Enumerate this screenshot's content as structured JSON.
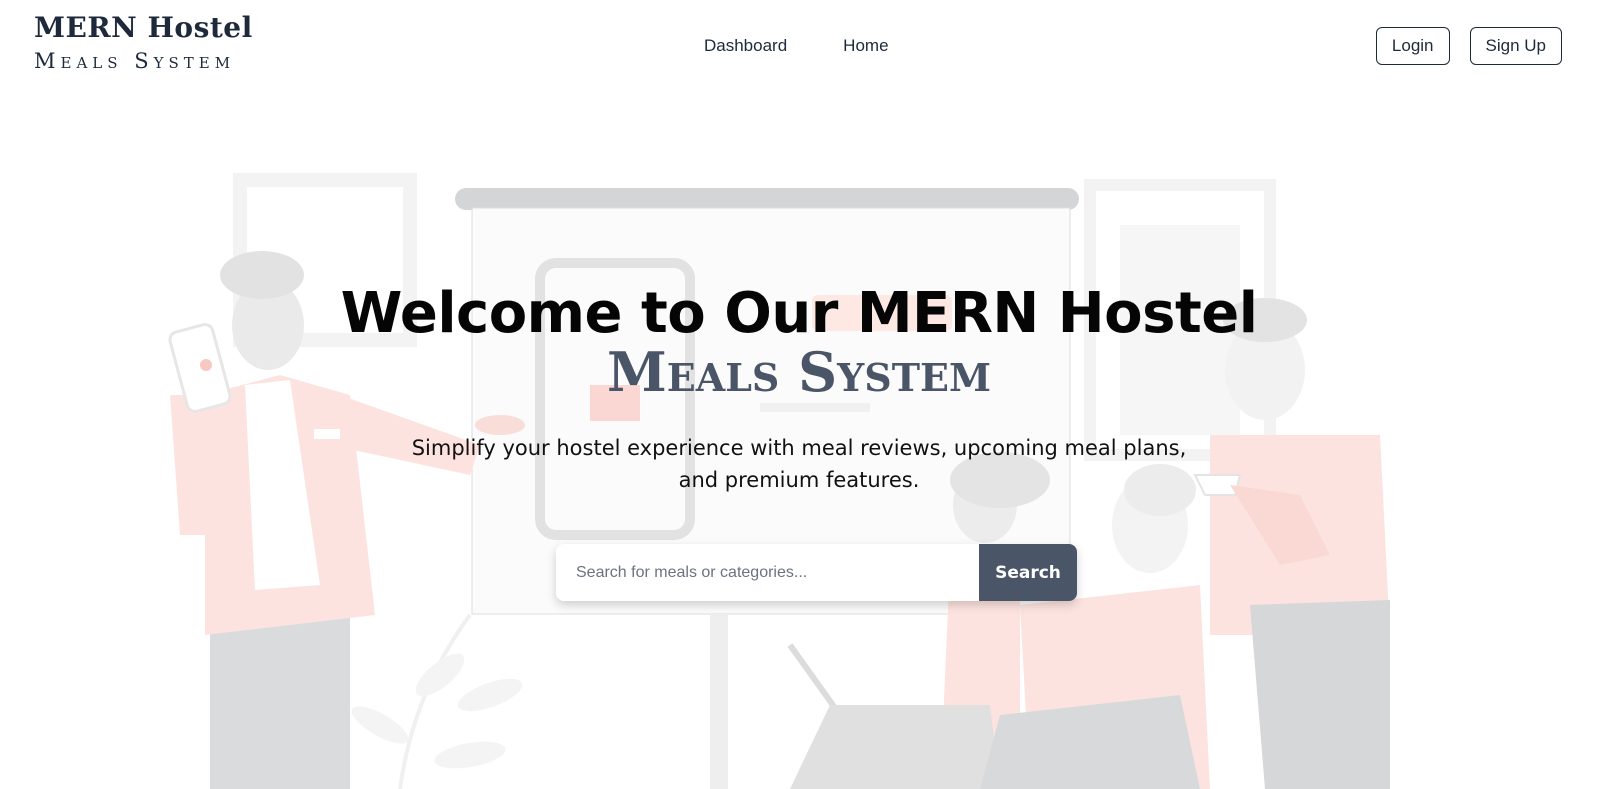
{
  "brand": {
    "line1": "MERN Hostel",
    "line2": "Meals System"
  },
  "nav": {
    "links": [
      {
        "label": "Dashboard"
      },
      {
        "label": "Home"
      }
    ]
  },
  "auth": {
    "login_label": "Login",
    "signup_label": "Sign Up"
  },
  "hero": {
    "title": "Welcome to Our MERN Hostel",
    "subtitle": "Meals System",
    "description": "Simplify your hostel experience with meal reviews, upcoming meal plans, and premium features.",
    "search": {
      "placeholder": "Search for meals or categories...",
      "value": "",
      "button_label": "Search"
    },
    "illustration": "team-meeting-presentation-illustration"
  },
  "colors": {
    "brand_dark": "#1e2a3b",
    "search_button": "#4a5568",
    "illustration_accent": "#fde1dd",
    "illustration_gray": "#d1d5db"
  }
}
